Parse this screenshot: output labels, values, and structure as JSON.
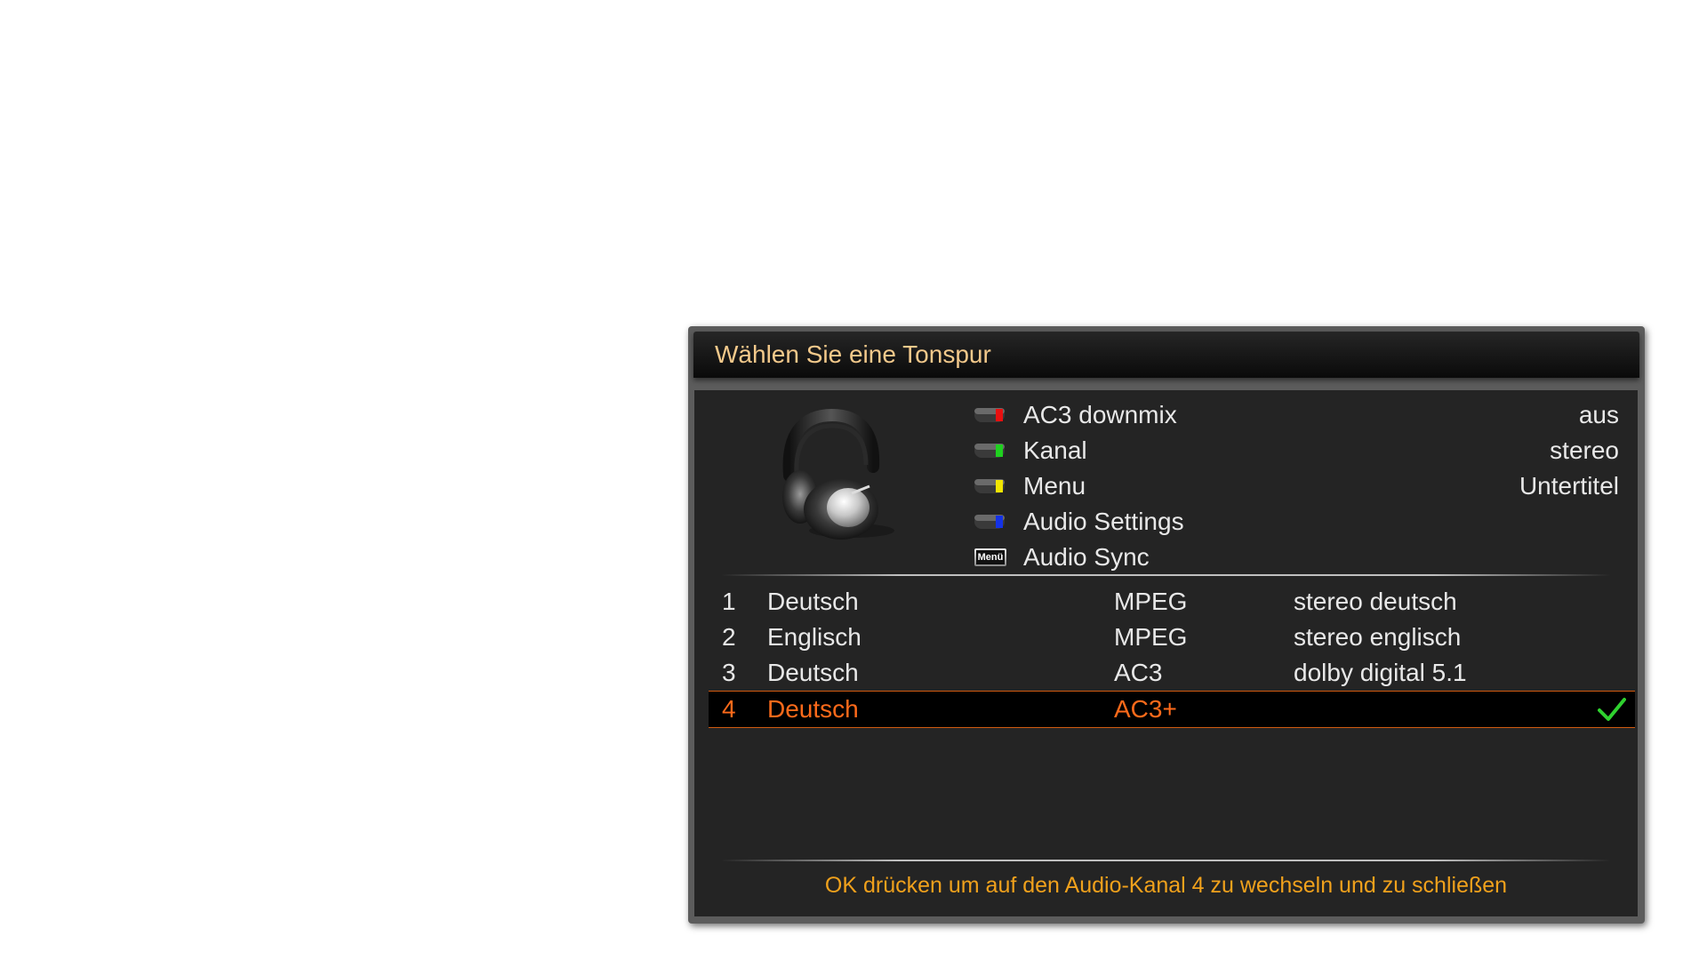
{
  "dialog": {
    "title": "Wählen Sie eine Tonspur",
    "image_icon": "headphones-icon",
    "options": [
      {
        "button": "red-button-icon",
        "color": "#e81010",
        "label": "AC3 downmix",
        "value": "aus"
      },
      {
        "button": "green-button-icon",
        "color": "#1fd11f",
        "label": "Kanal",
        "value": "stereo"
      },
      {
        "button": "yellow-button-icon",
        "color": "#f2e600",
        "label": "Menu",
        "value": "Untertitel"
      },
      {
        "button": "blue-button-icon",
        "color": "#1432e6",
        "label": "Audio Settings",
        "value": ""
      },
      {
        "button": "menu-button-icon",
        "button_text": "Menü",
        "label": "Audio Sync",
        "value": ""
      }
    ],
    "tracks": [
      {
        "num": "1",
        "language": "Deutsch",
        "codec": "MPEG",
        "description": "stereo deutsch",
        "selected": false
      },
      {
        "num": "2",
        "language": "Englisch",
        "codec": "MPEG",
        "description": "stereo englisch",
        "selected": false
      },
      {
        "num": "3",
        "language": "Deutsch",
        "codec": "AC3",
        "description": "dolby digital 5.1",
        "selected": false
      },
      {
        "num": "4",
        "language": "Deutsch",
        "codec": "AC3+",
        "description": "",
        "selected": true,
        "icon": "checkmark-icon"
      }
    ],
    "footer": "OK drücken um auf den Audio-Kanal 4 zu wechseln und zu schließen"
  },
  "colors": {
    "title": "#f3c98b",
    "selected_text": "#ff6a1a",
    "footer": "#f0a11c",
    "checkmark": "#2fd12f"
  }
}
